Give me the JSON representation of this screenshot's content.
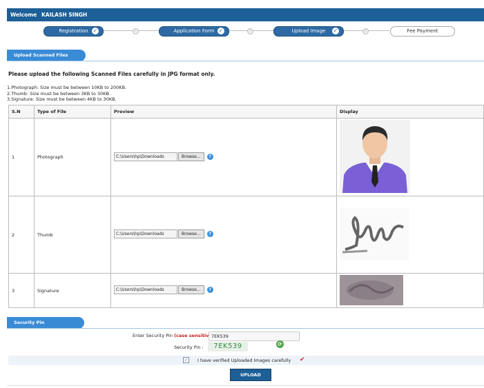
{
  "header": {
    "welcome": "Welcome",
    "user_name": "KAILASH SINGH"
  },
  "steps": [
    {
      "label": "Registration",
      "status": "done"
    },
    {
      "label": "Application Form",
      "status": "done"
    },
    {
      "label": "Upload Image",
      "status": "done"
    },
    {
      "label": "Fee Payment",
      "status": "pending"
    }
  ],
  "upload_section": {
    "tab_label": "Upload Scanned Files",
    "instruction": "Please upload the following Scanned Files carefully in JPG format only.",
    "notes": [
      "1.Photograph: Size must be between 10KB to 200KB.",
      "2.Thumb: Size must be between 3KB to 30KB.",
      "3.Signature: Size must be between 4KB to 30KB."
    ],
    "columns": [
      "S.N",
      "Type of File",
      "Preview",
      "Display"
    ],
    "rows": [
      {
        "sn": "1",
        "type": "Photograph",
        "path": "C:\\Users\\hp\\Downloads",
        "browse": "Browse..."
      },
      {
        "sn": "2",
        "type": "Thumb",
        "path": "C:\\Users\\hp\\Downloads",
        "browse": "Browse..."
      },
      {
        "sn": "3",
        "type": "Signature",
        "path": "C:\\Users\\hp\\Downloads",
        "browse": "Browse..."
      }
    ]
  },
  "security": {
    "tab_label": "Security Pin",
    "enter_label": "Enter Security Pin",
    "case_note": "(case sensitive)",
    "colon": ":",
    "pin_value": "7EK539",
    "pin_label": "Security Pin :",
    "captcha": "7EK539",
    "verify_label": "I have verified Uploaded Images carefully",
    "upload_button": "UPLOAD"
  },
  "colors": {
    "header": "#1d5f97",
    "accent": "#3a8bd6",
    "captcha": "#2f8f3a"
  }
}
